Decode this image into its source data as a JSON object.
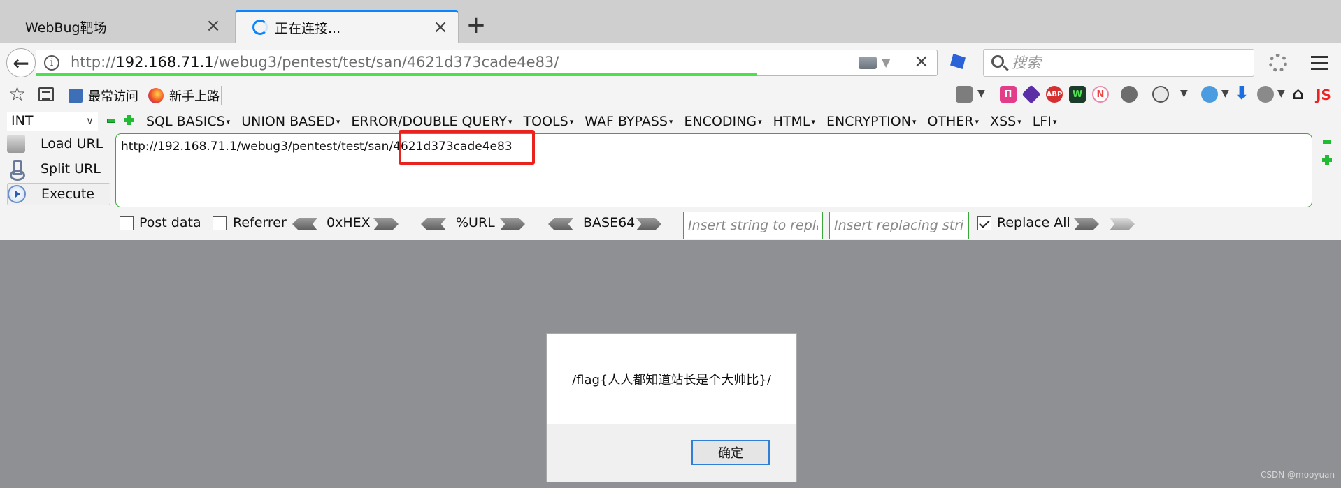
{
  "tabs": [
    {
      "title": "WebBug靶场",
      "close": "×"
    },
    {
      "title": "正在连接...",
      "close": "×"
    }
  ],
  "newtab_symbol": "+",
  "address": {
    "prefix": "http://",
    "host": "192.168.71.1",
    "path": "/webug3/pentest/test/san/4621d373cade4e83/",
    "progress": 0.8
  },
  "search": {
    "placeholder": "搜索"
  },
  "bookmarks": [
    {
      "label": "最常访问",
      "icon": "bookmark-folder-icon"
    },
    {
      "label": "新手上路",
      "icon": "firefox-icon"
    }
  ],
  "extensions": {
    "abp": "ABP",
    "w": "W",
    "n": "N",
    "js": "JS"
  },
  "hackbar": {
    "select": "INT",
    "menus": [
      "SQL BASICS",
      "UNION BASED",
      "ERROR/DOUBLE QUERY",
      "TOOLS",
      "WAF BYPASS",
      "ENCODING",
      "HTML",
      "ENCRYPTION",
      "OTHER",
      "XSS",
      "LFI"
    ],
    "load_url": "Load URL",
    "split_url": "Split URL",
    "execute": "Execute",
    "url_value": "http://192.168.71.1/webug3/pentest/test/san/4621d373cade4e83",
    "post_data": "Post data",
    "referrer": "Referrer",
    "hex": "0xHEX",
    "url_enc": "%URL",
    "base64": "BASE64",
    "insert_placeholder": "Insert string to replace",
    "replacing_placeholder": "Insert replacing string",
    "replace_all": "Replace All",
    "replace_all_checked": true
  },
  "dialog": {
    "message": "/flag{人人都知道站长是个大帅比}/",
    "ok": "确定"
  },
  "watermark": "CSDN @mooyuan",
  "colors": {
    "accent": "#0a84ff",
    "progress": "#4ce04c",
    "hackbar_border": "#3aa83a",
    "highlight": "#e8231d"
  }
}
